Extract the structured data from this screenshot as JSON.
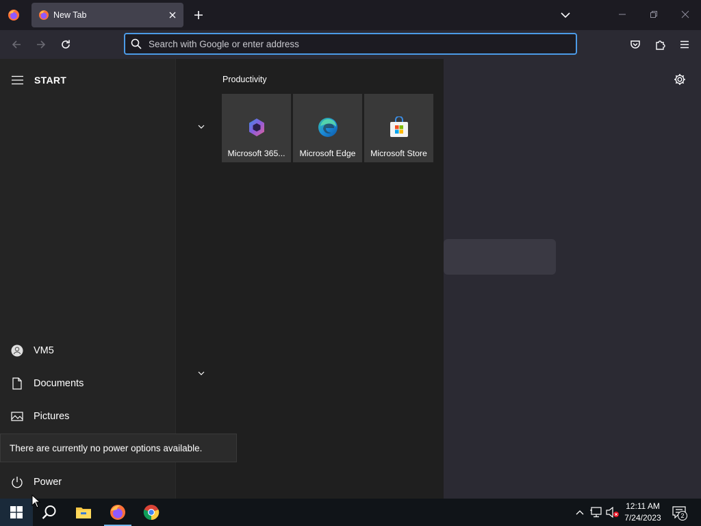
{
  "browser": {
    "tab_title": "New Tab",
    "urlbar_placeholder": "Search with Google or enter address"
  },
  "start_menu": {
    "title": "START",
    "group_label": "Productivity",
    "tiles": [
      {
        "label": "Microsoft 365...",
        "icon": "microsoft-365-icon"
      },
      {
        "label": "Microsoft Edge",
        "icon": "edge-icon"
      },
      {
        "label": "Microsoft Store",
        "icon": "store-icon"
      }
    ],
    "items": [
      {
        "label": "VM5",
        "icon": "user-icon"
      },
      {
        "label": "Documents",
        "icon": "document-icon"
      },
      {
        "label": "Pictures",
        "icon": "pictures-icon"
      },
      {
        "label": "Power",
        "icon": "power-icon"
      }
    ],
    "tooltip": "There are currently no power options available."
  },
  "taskbar": {
    "time": "12:11 AM",
    "date": "7/24/2023",
    "notification_count": "2"
  },
  "colors": {
    "urlbar_focus": "#4c9be8",
    "taskbar_accent": "#76b9ed"
  }
}
